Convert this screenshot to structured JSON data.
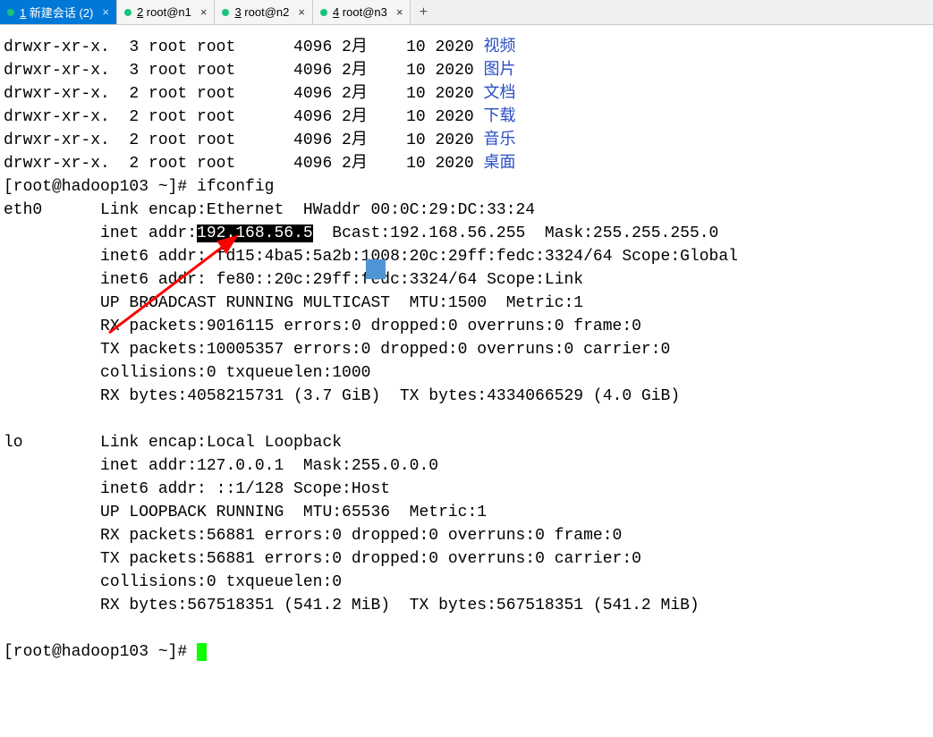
{
  "tabs": [
    {
      "num": "1",
      "label": "新建会话 (2)",
      "active": true
    },
    {
      "num": "2",
      "label": "root@n1",
      "active": false
    },
    {
      "num": "3",
      "label": "root@n2",
      "active": false
    },
    {
      "num": "4",
      "label": "root@n3",
      "active": false
    }
  ],
  "ls": [
    {
      "perm": "drwxr-xr-x.",
      "links": "3",
      "owner": "root",
      "group": "root",
      "size": "4096",
      "month": "2月",
      "day": "10",
      "year": "2020",
      "name": "视频"
    },
    {
      "perm": "drwxr-xr-x.",
      "links": "3",
      "owner": "root",
      "group": "root",
      "size": "4096",
      "month": "2月",
      "day": "10",
      "year": "2020",
      "name": "图片"
    },
    {
      "perm": "drwxr-xr-x.",
      "links": "2",
      "owner": "root",
      "group": "root",
      "size": "4096",
      "month": "2月",
      "day": "10",
      "year": "2020",
      "name": "文档"
    },
    {
      "perm": "drwxr-xr-x.",
      "links": "2",
      "owner": "root",
      "group": "root",
      "size": "4096",
      "month": "2月",
      "day": "10",
      "year": "2020",
      "name": "下载"
    },
    {
      "perm": "drwxr-xr-x.",
      "links": "2",
      "owner": "root",
      "group": "root",
      "size": "4096",
      "month": "2月",
      "day": "10",
      "year": "2020",
      "name": "音乐"
    },
    {
      "perm": "drwxr-xr-x.",
      "links": "2",
      "owner": "root",
      "group": "root",
      "size": "4096",
      "month": "2月",
      "day": "10",
      "year": "2020",
      "name": "桌面"
    }
  ],
  "prompt1": "[root@hadoop103 ~]# ",
  "cmd1": "ifconfig",
  "eth0": {
    "iface": "eth0",
    "l1": "Link encap:Ethernet  HWaddr 00:0C:29:DC:33:24",
    "l2a": "inet addr:",
    "l2sel": "192.168.56.5",
    "l2b": "  Bcast:192.168.56.255  Mask:255.255.255.0",
    "l3": "inet6 addr: fd15:4ba5:5a2b:1008:20c:29ff:fedc:3324/64 Scope:Global",
    "l4": "inet6 addr: fe80::20c:29ff:fedc:3324/64 Scope:Link",
    "l5": "UP BROADCAST RUNNING MULTICAST  MTU:1500  Metric:1",
    "l6": "RX packets:9016115 errors:0 dropped:0 overruns:0 frame:0",
    "l7": "TX packets:10005357 errors:0 dropped:0 overruns:0 carrier:0",
    "l8": "collisions:0 txqueuelen:1000",
    "l9": "RX bytes:4058215731 (3.7 GiB)  TX bytes:4334066529 (4.0 GiB)"
  },
  "lo": {
    "iface": "lo",
    "l1": "Link encap:Local Loopback",
    "l2": "inet addr:127.0.0.1  Mask:255.0.0.0",
    "l3": "inet6 addr: ::1/128 Scope:Host",
    "l4": "UP LOOPBACK RUNNING  MTU:65536  Metric:1",
    "l5": "RX packets:56881 errors:0 dropped:0 overruns:0 frame:0",
    "l6": "TX packets:56881 errors:0 dropped:0 overruns:0 carrier:0",
    "l7": "collisions:0 txqueuelen:0",
    "l8": "RX bytes:567518351 (541.2 MiB)  TX bytes:567518351 (541.2 MiB)"
  },
  "prompt2": "[root@hadoop103 ~]# ",
  "annotation": {
    "arrow_color": "#ff0000",
    "icon_bg": "#4f94d4"
  }
}
